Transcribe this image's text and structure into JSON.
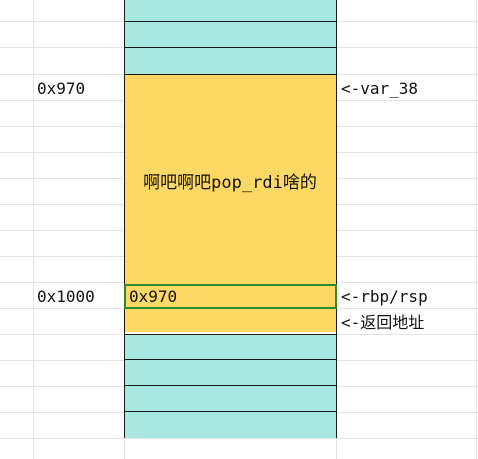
{
  "rows": {
    "addr_970": "0x970",
    "addr_1000": "0x1000",
    "pointer_var38": "<-var_38",
    "pointer_rbp_rsp": "<-rbp/rsp",
    "pointer_ret": "<-返回地址"
  },
  "stack": {
    "block_label": "啊吧啊吧pop_rdi啥的",
    "selected_cell_value": "0x970"
  },
  "colors": {
    "cyan_cell": "#a8e8e0",
    "yellow_block": "#fdd865",
    "selection_border": "#2e8b2e"
  }
}
